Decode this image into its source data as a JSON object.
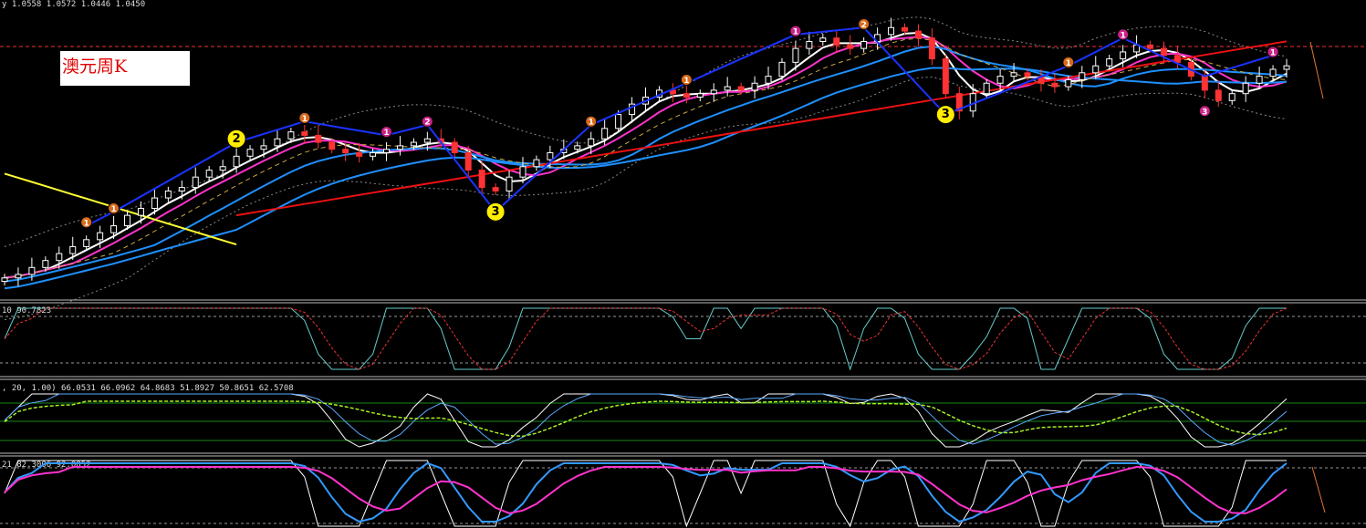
{
  "header": {
    "symbol_fragment": "y",
    "ohlc": "1.0558 1.0572 1.0446 1.0450"
  },
  "title_label": "澳元周K",
  "indicators": {
    "stoch_label": "10 90.7823",
    "macd_label": ", 20, 1.00) 66.0531 66.0962 64.8683 51.8927 50.8651 62.5708",
    "rsi_label": "21 82.3006 92.0852"
  },
  "colors": {
    "background": "#000000",
    "bull_candle": "#ffffff",
    "bear_candle": "#ff3333",
    "ma_white": "#ffffff",
    "ma_magenta": "#ff33cc",
    "ma_blue": "#1e90ff",
    "ma_red": "#ee1111",
    "ma_yellow": "#ffff33",
    "zigzag": "#1a33ff",
    "bands": "#888888",
    "marker_orange": "#d96a1a",
    "marker_magenta": "#cc2288",
    "marker_yellow": "#ffee00"
  },
  "chart_data": [
    {
      "type": "line",
      "name": "price",
      "points": 95,
      "close": [
        1.02,
        1.03,
        1.05,
        1.07,
        1.09,
        1.11,
        1.13,
        1.15,
        1.17,
        1.2,
        1.22,
        1.25,
        1.27,
        1.28,
        1.31,
        1.33,
        1.34,
        1.37,
        1.39,
        1.4,
        1.42,
        1.44,
        1.43,
        1.41,
        1.39,
        1.38,
        1.37,
        1.38,
        1.39,
        1.4,
        1.41,
        1.42,
        1.41,
        1.38,
        1.33,
        1.28,
        1.27,
        1.31,
        1.34,
        1.36,
        1.38,
        1.39,
        1.4,
        1.42,
        1.45,
        1.49,
        1.52,
        1.54,
        1.56,
        1.55,
        1.54,
        1.55,
        1.56,
        1.57,
        1.56,
        1.58,
        1.6,
        1.64,
        1.68,
        1.7,
        1.71,
        1.69,
        1.68,
        1.7,
        1.72,
        1.74,
        1.73,
        1.71,
        1.65,
        1.55,
        1.5,
        1.55,
        1.58,
        1.6,
        1.61,
        1.6,
        1.58,
        1.57,
        1.59,
        1.61,
        1.63,
        1.65,
        1.67,
        1.69,
        1.68,
        1.66,
        1.64,
        1.6,
        1.56,
        1.53,
        1.55,
        1.58,
        1.6,
        1.62,
        1.63
      ],
      "markers": [
        {
          "index": 6,
          "label": "1",
          "color": "orange"
        },
        {
          "index": 8,
          "label": "1",
          "color": "orange"
        },
        {
          "index": 17,
          "label": "2",
          "color": "yellow"
        },
        {
          "index": 22,
          "label": "1",
          "color": "orange"
        },
        {
          "index": 28,
          "label": "1",
          "color": "magenta"
        },
        {
          "index": 31,
          "label": "2",
          "color": "magenta"
        },
        {
          "index": 36,
          "label": "3",
          "color": "yellow"
        },
        {
          "index": 43,
          "label": "1",
          "color": "orange"
        },
        {
          "index": 50,
          "label": "1",
          "color": "orange"
        },
        {
          "index": 58,
          "label": "1",
          "color": "magenta"
        },
        {
          "index": 63,
          "label": "2",
          "color": "orange"
        },
        {
          "index": 69,
          "label": "3",
          "color": "yellow"
        },
        {
          "index": 78,
          "label": "1",
          "color": "orange"
        },
        {
          "index": 82,
          "label": "1",
          "color": "magenta"
        },
        {
          "index": 88,
          "label": "3",
          "color": "magenta"
        },
        {
          "index": 93,
          "label": "1",
          "color": "magenta"
        }
      ]
    }
  ]
}
